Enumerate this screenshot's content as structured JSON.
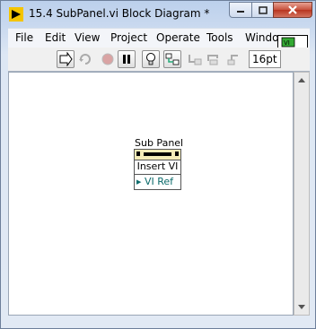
{
  "window": {
    "title": "15.4 SubPanel.vi Block Diagram *"
  },
  "menu": {
    "items": [
      "File",
      "Edit",
      "View",
      "Project",
      "Operate",
      "Tools",
      "Windo"
    ]
  },
  "toolbar": {
    "font_size": "16pt",
    "icons": [
      "run-arrow-icon",
      "run-continuously-icon",
      "abort-icon",
      "pause-icon",
      "highlight-execution-icon",
      "retain-wire-values-icon",
      "step-into-icon",
      "step-over-icon",
      "step-out-icon"
    ]
  },
  "vi_icon": {
    "badge": "1"
  },
  "diagram": {
    "node": {
      "label": "Sub Panel",
      "method": "Insert VI",
      "terminal": "VI Ref"
    }
  }
}
